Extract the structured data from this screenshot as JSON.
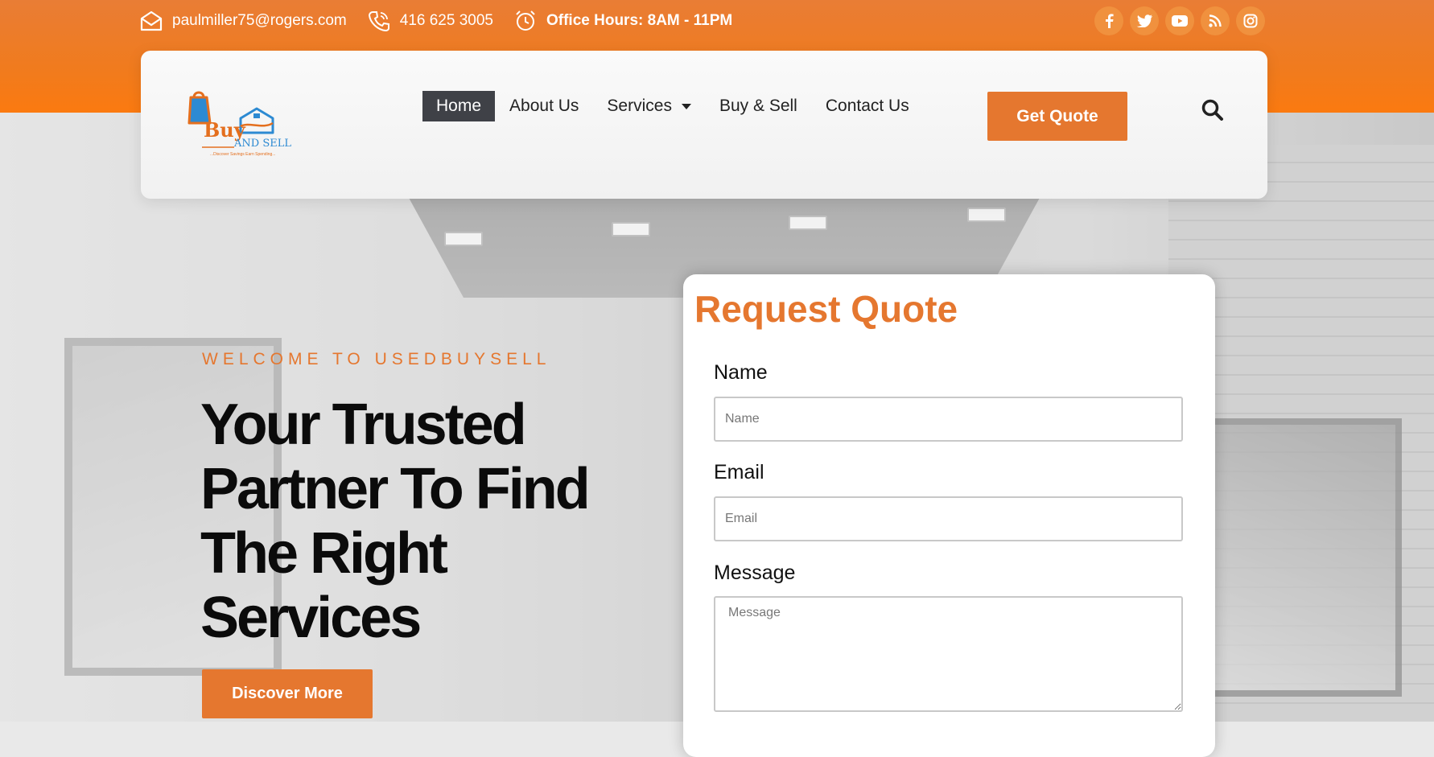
{
  "topbar": {
    "email": "paulmiller75@rogers.com",
    "phone": "416 625 3005",
    "hours": "Office Hours: 8AM - 11PM",
    "socials": [
      "facebook-icon",
      "twitter-icon",
      "youtube-icon",
      "rss-icon",
      "instagram-icon"
    ]
  },
  "header": {
    "logo": {
      "word1": "Buy",
      "word2": "AND SELL",
      "tagline": "...Discover Savings Earn Spending..."
    },
    "nav": [
      {
        "label": "Home",
        "active": true
      },
      {
        "label": "About Us"
      },
      {
        "label": "Services",
        "has_dropdown": true
      },
      {
        "label": "Buy & Sell"
      },
      {
        "label": "Contact Us"
      }
    ],
    "cta_label": "Get Quote"
  },
  "hero": {
    "eyebrow": "WELCOME TO USEDBUYSELL",
    "headline_lines": [
      "Your Trusted",
      "Partner To Find",
      "The Right",
      "Services"
    ],
    "button_label": "Discover More"
  },
  "form": {
    "title": "Request Quote",
    "name_label": "Name",
    "name_placeholder": "Name",
    "email_label": "Email",
    "email_placeholder": "Email",
    "message_label": "Message",
    "message_placeholder": "Message"
  },
  "colors": {
    "accent": "#e5772f",
    "nav_active_bg": "#3f4147",
    "top_band": "#f07b1e"
  }
}
